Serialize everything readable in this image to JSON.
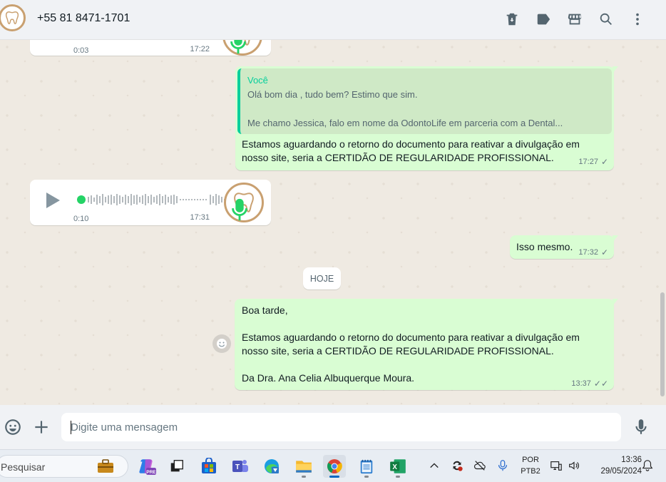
{
  "header": {
    "contact_name": "+55 81 8471-1701",
    "icons": [
      "trash-icon",
      "label-icon",
      "store-icon",
      "search-icon",
      "menu-icon"
    ]
  },
  "messages": {
    "voice_top": {
      "duration": "0:03",
      "time": "17:22"
    },
    "reply": {
      "quote_author": "Você",
      "quote_line1": "Olá bom dia , tudo bem? Estimo que sim.",
      "quote_line2": "Me chamo Jessica, falo em nome da OdontoLife em parceria com a Dental...",
      "body_line1": "Estamos aguardando o retorno do documento para reativar a divulgação em",
      "body_line2": "nosso site, seria a CERTIDÃO DE REGULARIDADE PROFISSIONAL.",
      "time": "17:27",
      "status": "sent"
    },
    "voice_mid": {
      "duration": "0:10",
      "time": "17:31",
      "progress": 0
    },
    "isso": {
      "text": "Isso mesmo.",
      "time": "17:32",
      "status": "sent"
    },
    "date_divider": "HOJE",
    "last": {
      "line1": "Boa tarde,",
      "line2": "Estamos aguardando o retorno do documento para reativar a divulgação em",
      "line3": "nosso site, seria a CERTIDÃO DE REGULARIDADE PROFISSIONAL.",
      "line4": "Da Dra. Ana Celia Albuquerque Moura.",
      "time": "13:37",
      "status": "delivered"
    }
  },
  "composer": {
    "placeholder": "Digite uma mensagem"
  },
  "taskbar": {
    "search_text": "Pesquisar",
    "lang_line1": "POR",
    "lang_line2": "PTB2",
    "time": "13:36",
    "date": "29/05/2024"
  },
  "colors": {
    "outgoing_bubble": "#d9fdd3",
    "incoming_bubble": "#ffffff",
    "accent_green": "#06cf9c",
    "chat_bg": "#efeae2"
  }
}
